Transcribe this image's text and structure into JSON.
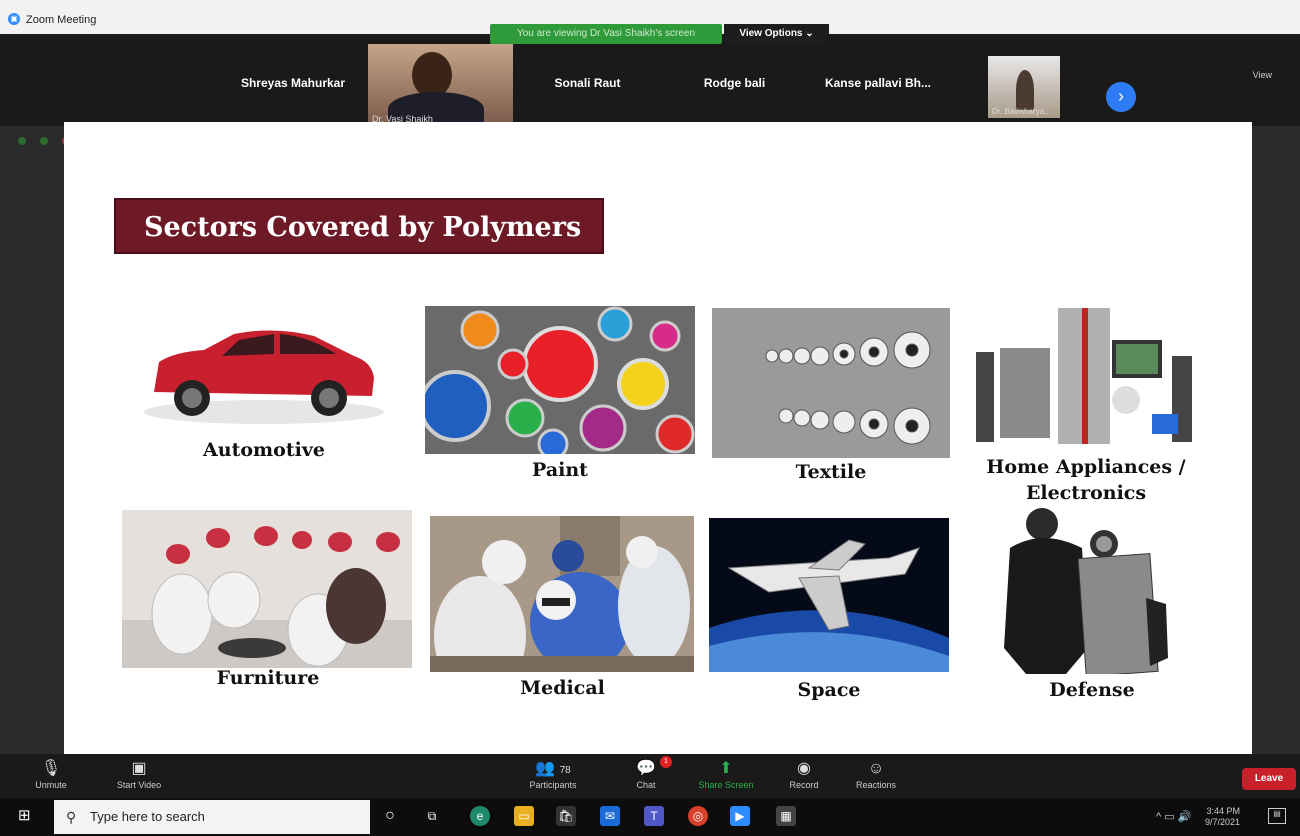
{
  "window": {
    "title": "Zoom Meeting",
    "share_banner": "You are viewing Dr Vasi Shaikh's screen",
    "view_options": "View Options ⌄",
    "speaker_view": "View"
  },
  "participants": [
    {
      "name": "Shreyas Mahurkar"
    },
    {
      "name": "Dr. Vasi Shaikh",
      "has_video": true
    },
    {
      "name": "Sonali Raut"
    },
    {
      "name": "Rodge bali"
    },
    {
      "name": "Kanse pallavi Bh..."
    },
    {
      "name": "Dr. Bavisharya..",
      "has_video": true
    }
  ],
  "slide": {
    "title": "Sectors Covered by Polymers",
    "sectors": [
      {
        "label": "Automotive"
      },
      {
        "label": "Paint"
      },
      {
        "label": "Textile"
      },
      {
        "label": "Home Appliances / Electronics"
      },
      {
        "label": "Furniture"
      },
      {
        "label": "Medical"
      },
      {
        "label": "Space"
      },
      {
        "label": "Defense"
      }
    ]
  },
  "zoom_toolbar": {
    "unmute": "Unmute",
    "start_video": "Start Video",
    "participants": "Participants",
    "participants_count": "78",
    "chat": "Chat",
    "chat_badge": "1",
    "share_screen": "Share Screen",
    "record": "Record",
    "reactions": "Reactions",
    "leave": "Leave"
  },
  "windows_taskbar": {
    "search_placeholder": "Type here to search",
    "time": "3:44 PM",
    "date": "9/7/2021"
  }
}
